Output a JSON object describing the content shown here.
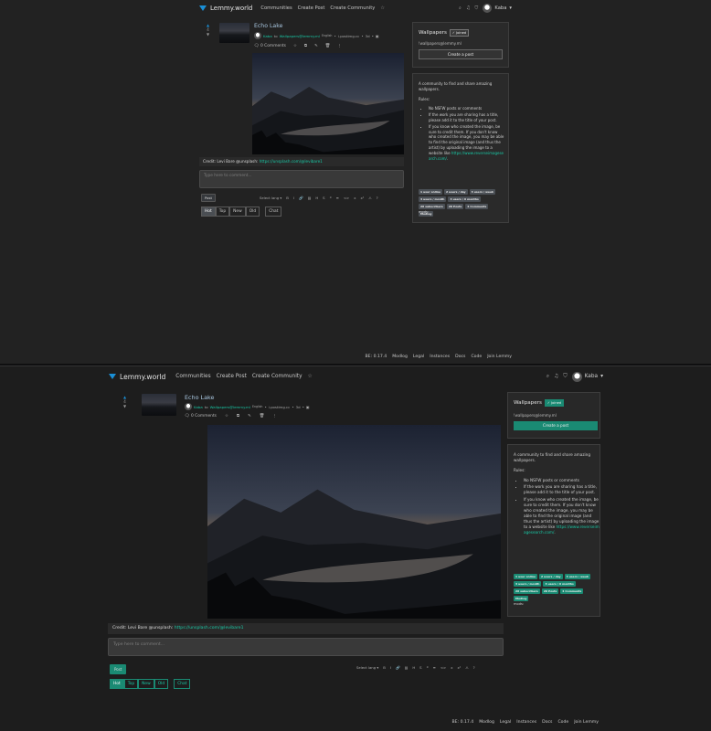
{
  "nav": {
    "brand": "Lemmy.world",
    "links": [
      "Communities",
      "Create Post",
      "Create Community"
    ],
    "user": "Kaba"
  },
  "post": {
    "score": "4",
    "title": "Echo Lake",
    "author": "Kaba",
    "to_word": "to",
    "community": "Wallpapers@lemmy.ml",
    "lang": "English",
    "origin": "i.postimg.cc",
    "age": "3d",
    "comments": "0 Comments",
    "body_text": "Credit: Levi Bare @unsplash: ",
    "body_link": "https://unsplash.com/@levibare1"
  },
  "comment": {
    "placeholder": "Type here to comment...",
    "post_label": "Post",
    "select_lang": "Select lang",
    "sorts": [
      "Hot",
      "Top",
      "New",
      "Old"
    ],
    "chat": "Chat"
  },
  "sidebar": {
    "title": "Wallpapers",
    "joined": "Joined",
    "handle": "!wallpapers@lemmy.ml",
    "create_post": "Create a post",
    "description": "A community to find and share amazing wallpapers.",
    "rules_title": "Rules:",
    "rules": [
      "No NSFW posts or comments",
      "If the work you are sharing has a title, please add it to the title of your post.",
      "If you know who created the image, be sure to credit them. If you don't know who created the image, you may be able to find the original image (and thus the artist) by uploading the image to a website like "
    ],
    "rule_link": "https://www.reverseimagesearch.com/",
    "rule_end": ".",
    "badges": [
      "1 user online",
      "2 users / day",
      "3 users / week",
      "3 users / month",
      "3 users / 6 months",
      "26 subscribers",
      "20 Posts",
      "4 Comments",
      "Modlog"
    ],
    "mods": "mods:"
  },
  "footer": {
    "version": "BE: 0.17.4",
    "links": [
      "Modlog",
      "Legal",
      "Instances",
      "Docs",
      "Code",
      "Join Lemmy"
    ]
  },
  "colors": {
    "accent": "#19c9a6",
    "brand": "#1a8fd6",
    "bg_dark": "#222222",
    "bg_light": "#1d1d1d"
  }
}
